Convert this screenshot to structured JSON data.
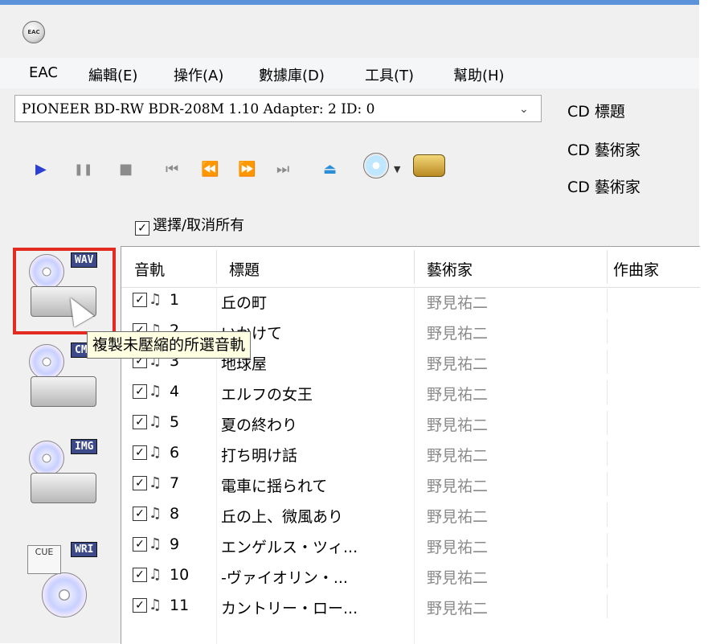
{
  "window": {
    "app_icon_text": "EAC"
  },
  "menu": [
    "EAC",
    "編輯(E)",
    "操作(A)",
    "數據庫(D)",
    "工具(T)",
    "幫助(H)"
  ],
  "drive": {
    "selected": "PIONEER BD-RW  BDR-208M 1.10  Adapter: 2  ID: 0"
  },
  "cd_info": {
    "title_label": "CD 標題",
    "artist_label": "CD 藝術家",
    "artist_label_2": "CD 藝術家"
  },
  "select_all_label": "選擇/取消所有",
  "actions": [
    {
      "tag": "WAV"
    },
    {
      "tag": "CMP"
    },
    {
      "tag": "IMG"
    },
    {
      "tag": "WRI"
    }
  ],
  "tooltip": "複製未壓縮的所選音軌",
  "columns": {
    "track": "音軌",
    "title": "標題",
    "artist": "藝術家",
    "composer": "作曲家"
  },
  "tracks": [
    {
      "num": "1",
      "title": "丘の町",
      "artist": "野見祐二"
    },
    {
      "num": "2",
      "title": "いかけて",
      "artist": "野見祐二"
    },
    {
      "num": "3",
      "title": "地球屋",
      "artist": "野見祐二"
    },
    {
      "num": "4",
      "title": "エルフの女王",
      "artist": "野見祐二"
    },
    {
      "num": "5",
      "title": "夏の終わり",
      "artist": "野見祐二"
    },
    {
      "num": "6",
      "title": "打ち明け話",
      "artist": "野見祐二"
    },
    {
      "num": "7",
      "title": "電車に揺られて",
      "artist": "野見祐二"
    },
    {
      "num": "8",
      "title": "丘の上、微風あり",
      "artist": "野見祐二"
    },
    {
      "num": "9",
      "title": "エンゲルス・ツィ...",
      "artist": "野見祐二"
    },
    {
      "num": "10",
      "title": "-ヴァイオリン・...",
      "artist": "野見祐二"
    },
    {
      "num": "11",
      "title": "カントリー・ロー...",
      "artist": "野見祐二"
    }
  ],
  "icons": {
    "play": "play-icon",
    "pause": "pause-icon",
    "stop": "stop-icon",
    "eject": "eject-icon"
  },
  "colors": {
    "highlight": "#e32b22",
    "play": "#2c3fd1",
    "eject": "#2a8fd6",
    "tag_bg": "#3c4a8a"
  }
}
